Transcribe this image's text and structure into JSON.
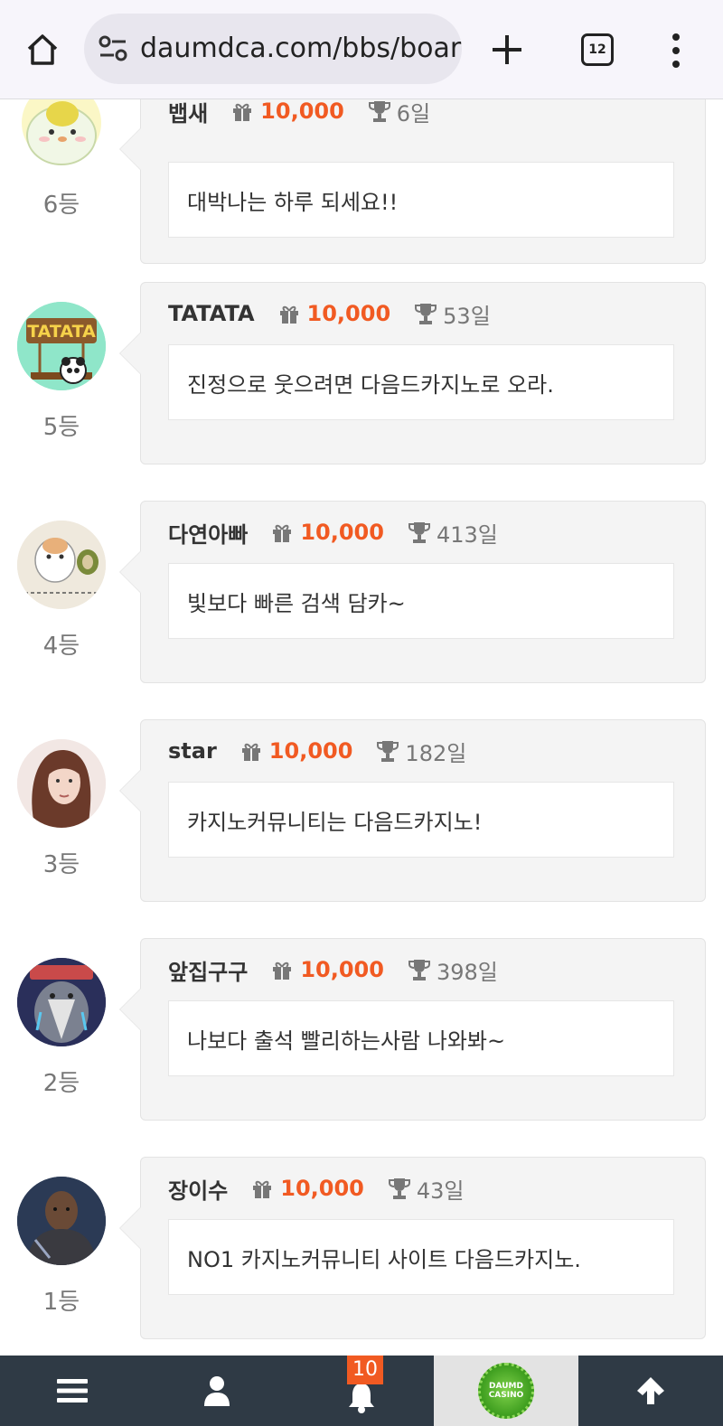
{
  "browser": {
    "url": "daumdca.com/bbs/board",
    "tab_count": "12",
    "icons": [
      "home-icon",
      "site-info-icon",
      "new-tab-icon",
      "tabs-icon",
      "more-menu-icon"
    ]
  },
  "entries": [
    {
      "rank": "6등",
      "nick": "뱁새",
      "points": "10,000",
      "days": "6일",
      "message": "대박나는 하루 되세요!!",
      "avatar": "yellow-bird-avatar"
    },
    {
      "rank": "5등",
      "nick": "TATATA",
      "points": "10,000",
      "days": "53일",
      "message": "진정으로 웃으려면 다음드카지노로 오라.",
      "avatar": "tatata-avatar",
      "avatar_text": "TATATA"
    },
    {
      "rank": "4등",
      "nick": "다연아빠",
      "points": "10,000",
      "days": "413일",
      "message": "빛보다 빠른 검색 담카~",
      "avatar": "hamster-avatar"
    },
    {
      "rank": "3등",
      "nick": "star",
      "points": "10,000",
      "days": "182일",
      "message": "카지노커뮤니티는 다음드카지노!",
      "avatar": "woman-avatar"
    },
    {
      "rank": "2등",
      "nick": "앞집구구",
      "points": "10,000",
      "days": "398일",
      "message": "나보다 출석 빨리하는사람 나와봐~",
      "avatar": "bird-avatar"
    },
    {
      "rank": "1등",
      "nick": "장이수",
      "points": "10,000",
      "days": "43일",
      "message": "NO1 카지노커뮤니티 사이트 다음드카지노.",
      "avatar": "man-avatar"
    }
  ],
  "bottom_nav": {
    "notification_count": "10",
    "logo_text": "DAUMD CASINO",
    "icons": [
      "menu-icon",
      "user-icon",
      "bell-icon",
      "logo",
      "arrow-up-icon"
    ]
  },
  "colors": {
    "accent": "#f15a22",
    "nav_bg": "#2f3a45",
    "card_bg": "#f4f4f4"
  }
}
